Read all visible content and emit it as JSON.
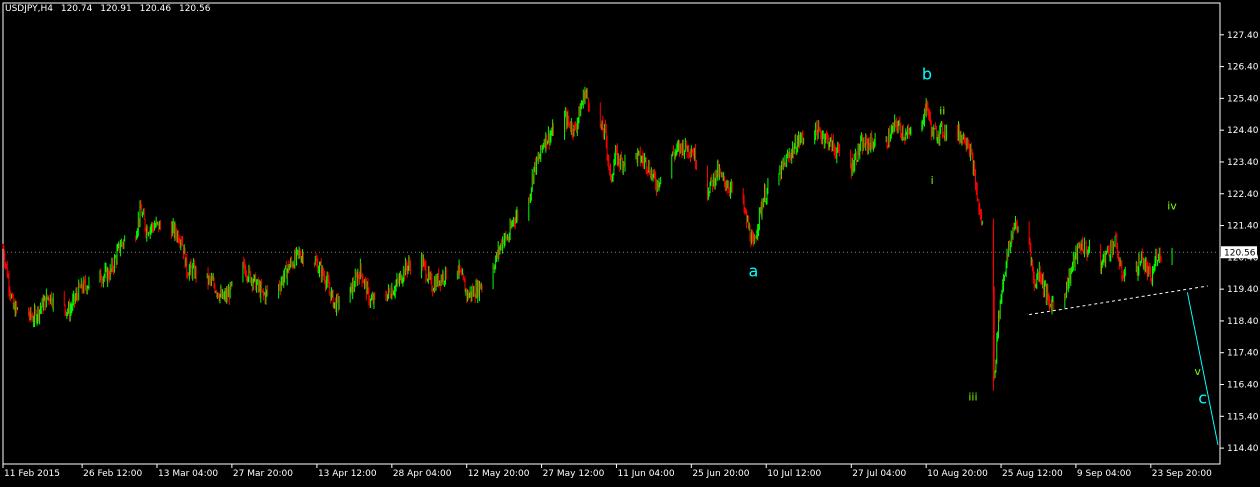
{
  "header": {
    "symbol": "USDJPY,H4",
    "open": "120.74",
    "high": "120.91",
    "low": "120.46",
    "close": "120.56"
  },
  "price_label": "120.56",
  "colors": {
    "background": "#000000",
    "bull": "#00ff00",
    "bear": "#ff0000",
    "axis": "#ffffff",
    "wave_major": "#00ffff",
    "wave_minor": "#7fff00",
    "projection": "#00ffff"
  },
  "chart_data": {
    "type": "candlestick",
    "title": "",
    "xlabel": "",
    "ylabel": "",
    "ylim": [
      113.9,
      128.4
    ],
    "y_ticks": [
      "127.40",
      "126.40",
      "125.40",
      "124.40",
      "123.40",
      "122.40",
      "121.40",
      "120.40",
      "119.40",
      "118.40",
      "117.40",
      "116.40",
      "115.40",
      "114.40"
    ],
    "x_ticks": [
      "11 Feb 2015",
      "26 Feb 12:00",
      "13 Mar 04:00",
      "27 Mar 20:00",
      "13 Apr 12:00",
      "28 Apr 04:00",
      "12 May 20:00",
      "27 May 12:00",
      "11 Jun 04:00",
      "25 Jun 20:00",
      "10 Jul 12:00",
      "27 Jul 04:00",
      "10 Aug 20:00",
      "25 Aug 12:00",
      "9 Sep 04:00",
      "23 Sep 20:00"
    ],
    "x_range": [
      "11 Feb 2015",
      "7 Oct 2015"
    ],
    "price_path": [
      [
        "11 Feb 2015",
        120.7
      ],
      [
        "13 Feb 2015",
        118.8
      ],
      [
        "17 Feb 2015",
        118.5
      ],
      [
        "20 Feb 2015",
        119.2
      ],
      [
        "24 Feb 2015",
        118.7
      ],
      [
        "26 Feb 2015",
        119.4
      ],
      [
        "2 Mar 2015",
        119.8
      ],
      [
        "4 Mar 2015",
        119.9
      ],
      [
        "6 Mar 2015",
        120.8
      ],
      [
        "9 Mar 2015",
        121.2
      ],
      [
        "10 Mar 2015",
        121.9
      ],
      [
        "11 Mar 2015",
        121.3
      ],
      [
        "13 Mar 2015",
        121.4
      ],
      [
        "16 Mar 2015",
        121.3
      ],
      [
        "18 Mar 2015",
        121.0
      ],
      [
        "19 Mar 2015",
        120.0
      ],
      [
        "20 Mar 2015",
        120.0
      ],
      [
        "24 Mar 2015",
        119.6
      ],
      [
        "26 Mar 2015",
        119.1
      ],
      [
        "27 Mar 2015",
        119.2
      ],
      [
        "30 Mar 2015",
        120.1
      ],
      [
        "1 Apr 2015",
        119.7
      ],
      [
        "3 Apr 2015",
        119.2
      ],
      [
        "6 Apr 2015",
        119.5
      ],
      [
        "8 Apr 2015",
        120.1
      ],
      [
        "10 Apr 2015",
        120.5
      ],
      [
        "13 Apr 2015",
        120.3
      ],
      [
        "15 Apr 2015",
        119.8
      ],
      [
        "17 Apr 2015",
        118.9
      ],
      [
        "20 Apr 2015",
        119.3
      ],
      [
        "22 Apr 2015",
        120.0
      ],
      [
        "24 Apr 2015",
        119.0
      ],
      [
        "27 Apr 2015",
        119.2
      ],
      [
        "29 Apr 2015",
        119.5
      ],
      [
        "1 May 2015",
        120.1
      ],
      [
        "4 May 2015",
        120.3
      ],
      [
        "6 May 2015",
        119.5
      ],
      [
        "8 May 2015",
        119.8
      ],
      [
        "11 May 2015",
        120.1
      ],
      [
        "13 May 2015",
        119.2
      ],
      [
        "15 May 2015",
        119.4
      ],
      [
        "18 May 2015",
        120.1
      ],
      [
        "20 May 2015",
        121.0
      ],
      [
        "21 May 2015",
        121.0
      ],
      [
        "22 May 2015",
        121.6
      ],
      [
        "25 May 2015",
        122.2
      ],
      [
        "26 May 2015",
        123.2
      ],
      [
        "27 May 2015",
        123.5
      ],
      [
        "28 May 2015",
        124.1
      ],
      [
        "29 May 2015",
        124.2
      ],
      [
        "1 Jun 2015",
        124.8
      ],
      [
        "3 Jun 2015",
        124.4
      ],
      [
        "5 Jun 2015",
        125.6
      ],
      [
        "8 Jun 2015",
        124.5
      ],
      [
        "9 Jun 2015",
        124.3
      ],
      [
        "10 Jun 2015",
        122.8
      ],
      [
        "11 Jun 2015",
        123.6
      ],
      [
        "12 Jun 2015",
        123.4
      ],
      [
        "15 Jun 2015",
        123.6
      ],
      [
        "17 Jun 2015",
        123.4
      ],
      [
        "19 Jun 2015",
        122.7
      ],
      [
        "22 Jun 2015",
        123.6
      ],
      [
        "24 Jun 2015",
        123.9
      ],
      [
        "26 Jun 2015",
        123.8
      ],
      [
        "29 Jun 2015",
        122.5
      ],
      [
        "1 Jul 2015",
        123.1
      ],
      [
        "2 Jul 2015",
        122.8
      ],
      [
        "3 Jul 2015",
        122.7
      ],
      [
        "6 Jul 2015",
        122.0
      ],
      [
        "8 Jul 2015",
        120.7
      ],
      [
        "9 Jul 2015",
        121.6
      ],
      [
        "10 Jul 2015",
        122.3
      ],
      [
        "13 Jul 2015",
        123.0
      ],
      [
        "15 Jul 2015",
        123.6
      ],
      [
        "17 Jul 2015",
        124.1
      ],
      [
        "20 Jul 2015",
        124.4
      ],
      [
        "22 Jul 2015",
        124.2
      ],
      [
        "24 Jul 2015",
        123.8
      ],
      [
        "27 Jul 2015",
        123.2
      ],
      [
        "29 Jul 2015",
        123.9
      ],
      [
        "31 Jul 2015",
        124.0
      ],
      [
        "3 Aug 2015",
        124.0
      ],
      [
        "5 Aug 2015",
        124.6
      ],
      [
        "7 Aug 2015",
        124.2
      ],
      [
        "10 Aug 2015",
        124.7
      ],
      [
        "11 Aug 2015",
        125.2
      ],
      [
        "12 Aug 2015",
        124.3
      ],
      [
        "13 Aug 2015",
        124.3
      ],
      [
        "14 Aug 2015",
        124.4
      ],
      [
        "17 Aug 2015",
        124.3
      ],
      [
        "19 Aug 2015",
        124.1
      ],
      [
        "20 Aug 2015",
        123.3
      ],
      [
        "21 Aug 2015",
        122.1
      ],
      [
        "24 Aug 2015",
        119.5
      ],
      [
        "24 Aug 2015",
        116.2
      ],
      [
        "25 Aug 2015",
        118.5
      ],
      [
        "26 Aug 2015",
        119.8
      ],
      [
        "27 Aug 2015",
        120.6
      ],
      [
        "28 Aug 2015",
        121.4
      ],
      [
        "31 Aug 2015",
        121.0
      ],
      [
        "1 Sep 2015",
        119.5
      ],
      [
        "2 Sep 2015",
        120.0
      ],
      [
        "4 Sep 2015",
        118.9
      ],
      [
        "7 Sep 2015",
        119.3
      ],
      [
        "9 Sep 2015",
        120.4
      ],
      [
        "10 Sep 2015",
        120.8
      ],
      [
        "11 Sep 2015",
        120.7
      ],
      [
        "14 Sep 2015",
        120.1
      ],
      [
        "15 Sep 2015",
        120.5
      ],
      [
        "17 Sep 2015",
        120.9
      ],
      [
        "18 Sep 2015",
        119.9
      ],
      [
        "21 Sep 2015",
        120.0
      ],
      [
        "22 Sep 2015",
        120.4
      ],
      [
        "23 Sep 2015",
        120.0
      ],
      [
        "24 Sep 2015",
        119.7
      ],
      [
        "25 Sep 2015",
        120.5
      ],
      [
        "28 Sep 2015",
        120.56
      ]
    ],
    "wave_labels": [
      {
        "text": "a",
        "date": "8 Jul 2015",
        "price": 119.8,
        "color": "#00ffff",
        "size": 16
      },
      {
        "text": "b",
        "date": "11 Aug 2015",
        "price": 126.0,
        "color": "#00ffff",
        "size": 16
      },
      {
        "text": "ii",
        "date": "14 Aug 2015",
        "price": 124.9,
        "color": "#7fff00",
        "size": 11
      },
      {
        "text": "i",
        "date": "12 Aug 2015",
        "price": 122.7,
        "color": "#7fff00",
        "size": 11
      },
      {
        "text": "iii",
        "date": "20 Aug 2015",
        "price": 115.9,
        "color": "#7fff00",
        "size": 11
      },
      {
        "text": "iv",
        "date": "28 Sep 2015",
        "price": 121.9,
        "color": "#7fff00",
        "size": 11
      },
      {
        "text": "v",
        "date": "3 Oct 2015",
        "price": 116.7,
        "color": "#7fff00",
        "size": 11
      },
      {
        "text": "c",
        "date": "4 Oct 2015",
        "price": 115.8,
        "color": "#00ffff",
        "size": 16
      }
    ],
    "trendline": {
      "from": [
        "31 Aug 2015",
        118.6
      ],
      "to": [
        "5 Oct 2015",
        119.5
      ],
      "style": "dashed",
      "color": "#ffffff"
    },
    "projection": {
      "from": [
        "1 Oct 2015",
        119.3
      ],
      "to": [
        "7 Oct 2015",
        114.5
      ],
      "style": "solid",
      "color": "#00ffff"
    },
    "grid": false
  }
}
